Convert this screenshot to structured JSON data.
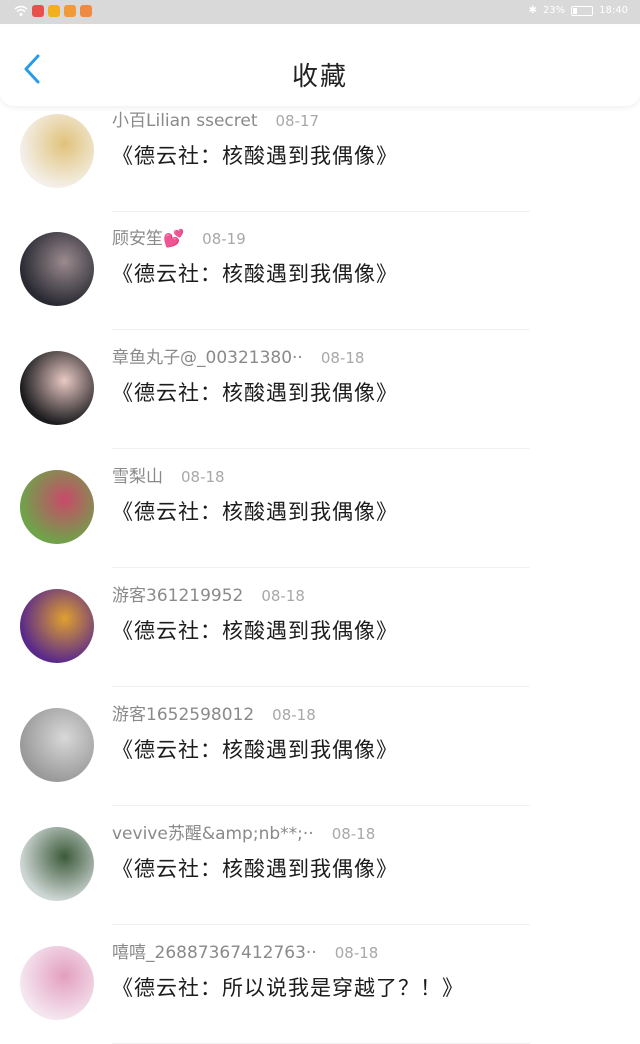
{
  "status_bar": {
    "battery_text": "23%",
    "time": "18:40",
    "battery_level": 0.23
  },
  "header": {
    "title": "收藏"
  },
  "items": [
    {
      "user": "小百Lilian ssecret",
      "date": "08-17",
      "text": "《德云社：核酸遇到我偶像》",
      "avatar_colors": [
        "#f4efe8",
        "#e0c27a"
      ]
    },
    {
      "user": "顾安笙",
      "date": "08-19",
      "text": "《德云社：核酸遇到我偶像》",
      "avatar_colors": [
        "#2a2a33",
        "#9b8b8f"
      ]
    },
    {
      "user": "章鱼丸子@_00321380··",
      "date": "08-18",
      "text": "《德云社：核酸遇到我偶像》",
      "avatar_colors": [
        "#1c1c1f",
        "#e9c9c3"
      ]
    },
    {
      "user": "雪梨山",
      "date": "08-18",
      "text": "《德云社：核酸遇到我偶像》",
      "avatar_colors": [
        "#6fa34a",
        "#c84a6a"
      ]
    },
    {
      "user": "游客361219952",
      "date": "08-18",
      "text": "《德云社：核酸遇到我偶像》",
      "avatar_colors": [
        "#5a2a8a",
        "#e0a030"
      ]
    },
    {
      "user": "游客1652598012",
      "date": "08-18",
      "text": "《德云社：核酸遇到我偶像》",
      "avatar_colors": [
        "#9a9a9a",
        "#d8d8d8"
      ]
    },
    {
      "user": "vevive苏醒&amp;nb**;··",
      "date": "08-18",
      "text": "《德云社：核酸遇到我偶像》",
      "avatar_colors": [
        "#cdd6d4",
        "#3d5a3a"
      ]
    },
    {
      "user": "嘻嘻_26887367412763··",
      "date": "08-18",
      "text": "《德云社：所以说我是穿越了？！》",
      "avatar_colors": [
        "#f4e6ef",
        "#e39ec0"
      ]
    }
  ]
}
